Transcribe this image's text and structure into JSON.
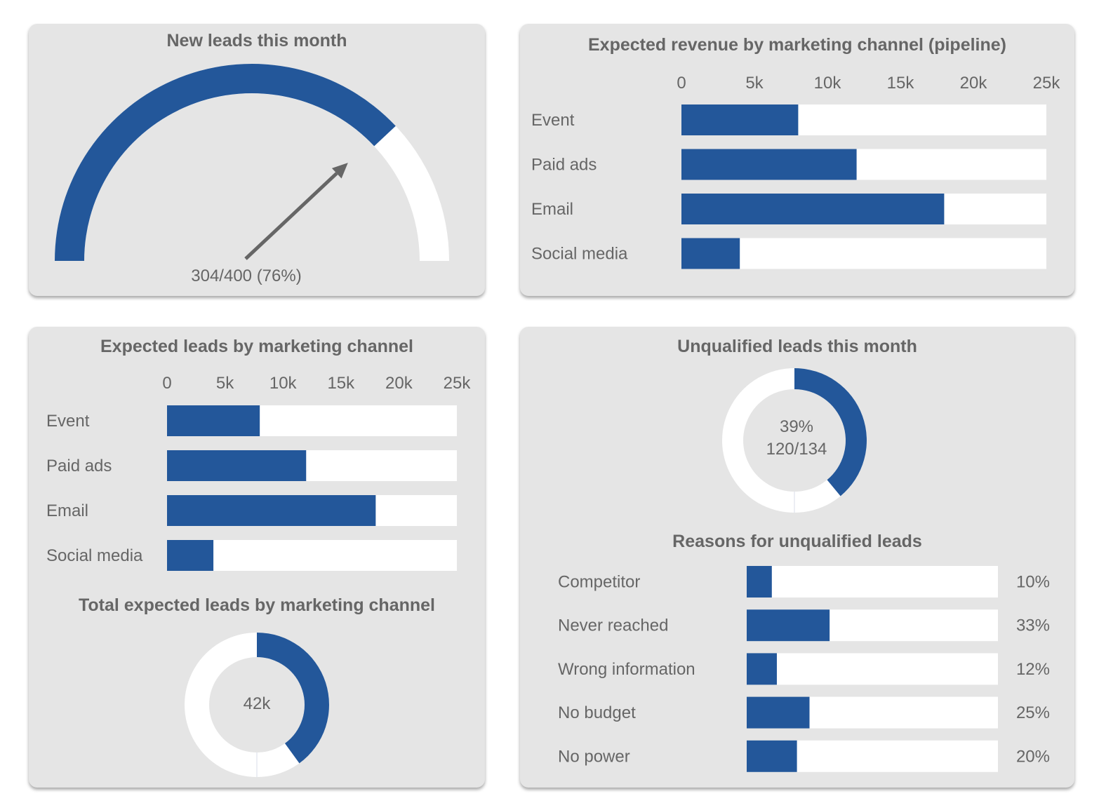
{
  "colors": {
    "accent": "#23579a",
    "track": "#ffffff",
    "panel": "#e5e5e5",
    "text": "#666666",
    "needle": "#666666"
  },
  "chart_data": [
    {
      "id": "gauge",
      "type": "gauge",
      "title": "New leads this month",
      "value": 304,
      "max": 400,
      "percent": 76,
      "label": "304/400 (76%)"
    },
    {
      "id": "revenue",
      "type": "bar",
      "orientation": "horizontal",
      "title": "Expected revenue by marketing channel (pipeline)",
      "categories": [
        "Event",
        "Paid ads",
        "Email",
        "Social media"
      ],
      "values": [
        8000,
        12000,
        18000,
        4000
      ],
      "xlim": [
        0,
        25000
      ],
      "ticks": [
        "0",
        "5k",
        "10k",
        "15k",
        "20k",
        "25k"
      ],
      "tick_values": [
        0,
        5000,
        10000,
        15000,
        20000,
        25000
      ],
      "axis_position": "top"
    },
    {
      "id": "leads",
      "type": "bar",
      "orientation": "horizontal",
      "title": "Expected leads by marketing channel",
      "categories": [
        "Event",
        "Paid ads",
        "Email",
        "Social media"
      ],
      "values": [
        8000,
        12000,
        18000,
        4000
      ],
      "xlim": [
        0,
        25000
      ],
      "ticks": [
        "0",
        "5k",
        "10k",
        "15k",
        "20k",
        "25k"
      ],
      "tick_values": [
        0,
        5000,
        10000,
        15000,
        20000,
        25000
      ],
      "axis_position": "top"
    },
    {
      "id": "total_leads",
      "type": "pie",
      "variant": "donut",
      "title": "Total expected leads by marketing channel",
      "center_label": "42k",
      "filled_fraction": 0.4
    },
    {
      "id": "unqualified",
      "type": "pie",
      "variant": "donut",
      "title": "Unqualified leads this month",
      "center_label_line1": "39%",
      "center_label_line2": "120/134",
      "filled_fraction": 0.39
    },
    {
      "id": "reasons",
      "type": "bar",
      "orientation": "horizontal",
      "title": "Reasons for unqualified leads",
      "categories": [
        "Competitor",
        "Never reached",
        "Wrong information",
        "No budget",
        "No power"
      ],
      "values": [
        10,
        33,
        12,
        25,
        20
      ],
      "value_labels": [
        "10%",
        "33%",
        "12%",
        "25%",
        "20%"
      ],
      "xlim": [
        0,
        100
      ]
    }
  ]
}
